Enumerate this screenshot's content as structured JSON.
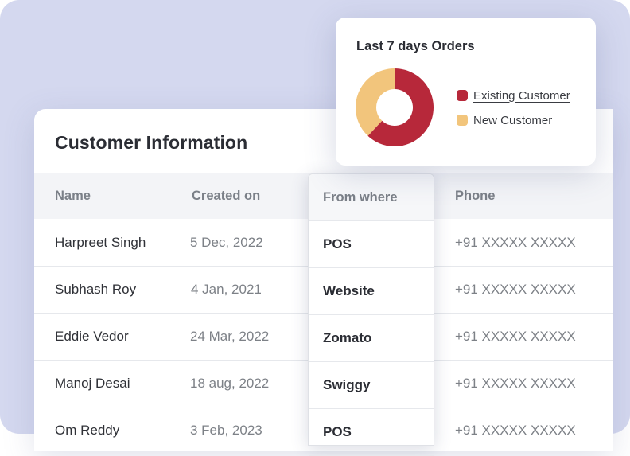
{
  "customer_table": {
    "title": "Customer Information",
    "columns": [
      "Name",
      "Created on",
      "From where",
      "Phone"
    ],
    "rows": [
      {
        "name": "Harpreet Singh",
        "created_on": "5 Dec, 2022",
        "from_where": "POS",
        "phone": "+91 XXXXX XXXXX"
      },
      {
        "name": "Subhash Roy",
        "created_on": "4 Jan, 2021",
        "from_where": "Website",
        "phone": "+91 XXXXX XXXXX"
      },
      {
        "name": "Eddie Vedor",
        "created_on": "24 Mar, 2022",
        "from_where": "Zomato",
        "phone": "+91 XXXXX XXXXX"
      },
      {
        "name": "Manoj Desai",
        "created_on": "18 aug, 2022",
        "from_where": "Swiggy",
        "phone": "+91 XXXXX XXXXX"
      },
      {
        "name": "Om Reddy",
        "created_on": "3 Feb, 2023",
        "from_where": "POS",
        "phone": "+91 XXXXX XXXXX"
      }
    ]
  },
  "orders_popup": {
    "title": "Last 7 days Orders",
    "legend": [
      {
        "label": "Existing Customer",
        "color": "#b7283a"
      },
      {
        "label": "New Customer",
        "color": "#f2c57c"
      }
    ]
  },
  "chart_data": {
    "type": "pie",
    "title": "Last 7 days Orders",
    "categories": [
      "Existing Customer",
      "New Customer"
    ],
    "values": [
      62,
      38
    ],
    "colors": [
      "#b7283a",
      "#f2c57c"
    ]
  },
  "colors": {
    "background": "#d4d8ef",
    "existing_customer": "#b7283a",
    "new_customer": "#f2c57c"
  }
}
